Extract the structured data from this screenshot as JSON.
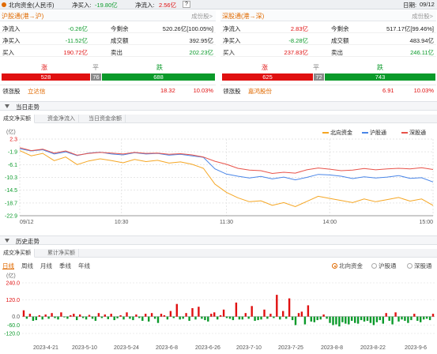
{
  "topbar": {
    "title": "北向资金(人民币)",
    "net_buy_label": "净买入:",
    "net_buy_value": "-19.80亿",
    "net_inflow_label": "净流入:",
    "net_inflow_value": "2.56亿",
    "help_icon": "?",
    "date_label": "日期:",
    "date_value": "09/12"
  },
  "sh_panel": {
    "title": "沪股通(港→沪)",
    "more": "成份股>",
    "rows": [
      {
        "l1": "净流入",
        "v1": "-0.26亿",
        "c1": "green",
        "l2": "今剩余",
        "v2": "520.26亿[100.05%]",
        "c2": "normal"
      },
      {
        "l1": "净买入",
        "v1": "-11.52亿",
        "c1": "green",
        "l2": "成交额",
        "v2": "392.95亿",
        "c2": "normal"
      },
      {
        "l1": "买入",
        "v1": "190.72亿",
        "c1": "red",
        "l2": "卖出",
        "v2": "202.23亿",
        "c2": "green"
      }
    ],
    "up_label": "涨",
    "flat_label": "平",
    "down_label": "跌",
    "up": "528",
    "flat": "76",
    "down": "688",
    "leader_label": "领涨股",
    "leader_name": "立达信",
    "leader_price": "18.32",
    "leader_pct": "10.03%"
  },
  "sz_panel": {
    "title": "深股通(港→深)",
    "more": "成份股>",
    "rows": [
      {
        "l1": "净流入",
        "v1": "2.83亿",
        "c1": "red",
        "l2": "今剩余",
        "v2": "517.17亿[99.46%]",
        "c2": "normal"
      },
      {
        "l1": "净买入",
        "v1": "-8.28亿",
        "c1": "green",
        "l2": "成交额",
        "v2": "483.94亿",
        "c2": "normal"
      },
      {
        "l1": "买入",
        "v1": "237.83亿",
        "c1": "red",
        "l2": "卖出",
        "v2": "246.11亿",
        "c2": "green"
      }
    ],
    "up_label": "涨",
    "flat_label": "平",
    "down_label": "跌",
    "up": "625",
    "flat": "72",
    "down": "743",
    "leader_label": "领涨股",
    "leader_name": "嘉鸿股份",
    "leader_price": "6.91",
    "leader_pct": "10.03%"
  },
  "intraday": {
    "section_title": "当日走势",
    "tabs": [
      "成交净买额",
      "资金净流入",
      "当日资金余额"
    ],
    "unit": "(亿)",
    "legend": [
      "北向资金",
      "沪股通",
      "深股通"
    ],
    "colors": {
      "north": "#f5a623",
      "sh": "#4a86e8",
      "sz": "#e8534a"
    },
    "chart_data": {
      "type": "line",
      "x_ticks": [
        "09/12",
        "10:30",
        "11:30",
        "14:00",
        "15:00"
      ],
      "y_ticks": [
        "2.3",
        "-1.9",
        "-6.1",
        "-10.3",
        "-14.5",
        "-18.7",
        "-22.9"
      ],
      "ylim": [
        -22.9,
        2.3
      ],
      "series": [
        {
          "name": "北向资金",
          "values": [
            -1.5,
            -3.2,
            -2.4,
            -4.8,
            -3.6,
            -6.1,
            -4.9,
            -4.2,
            -4.8,
            -5.5,
            -4.4,
            -5.1,
            -4.7,
            -5.6,
            -5.2,
            -6.0,
            -7.3,
            -12.5,
            -15.2,
            -17.0,
            -18.3,
            -18.0,
            -19.5,
            -18.6,
            -19.9,
            -18.2,
            -16.5,
            -17.2,
            -17.9,
            -18.6,
            -17.4,
            -18.3,
            -17.6,
            -16.9,
            -18.1,
            -17.4,
            -19.5
          ]
        },
        {
          "name": "沪股通",
          "values": [
            -0.9,
            -1.6,
            -1.2,
            -2.6,
            -1.9,
            -3.1,
            -2.3,
            -2.0,
            -2.6,
            -2.9,
            -2.2,
            -2.6,
            -2.4,
            -3.0,
            -2.7,
            -3.2,
            -3.7,
            -7.5,
            -9.2,
            -9.9,
            -10.5,
            -10.0,
            -10.8,
            -10.2,
            -11.1,
            -10.3,
            -9.3,
            -9.5,
            -9.9,
            -10.7,
            -10.1,
            -10.5,
            -10.2,
            -9.7,
            -10.6,
            -10.4,
            -11.8
          ]
        },
        {
          "name": "深股通",
          "values": [
            -0.5,
            -1.5,
            -1.0,
            -2.3,
            -1.6,
            -3.0,
            -2.4,
            -2.1,
            -2.3,
            -2.6,
            -2.1,
            -2.4,
            -2.3,
            -2.7,
            -2.5,
            -2.9,
            -3.6,
            -5.0,
            -6.0,
            -7.3,
            -7.9,
            -8.1,
            -9.0,
            -8.6,
            -8.9,
            -7.8,
            -7.2,
            -7.6,
            -8.1,
            -7.9,
            -7.4,
            -7.8,
            -7.5,
            -7.3,
            -7.5,
            -7.1,
            -7.7
          ]
        }
      ]
    }
  },
  "history": {
    "section_title": "历史走势",
    "tabs": [
      "成交净买额",
      "累计净买额"
    ],
    "periods": [
      "日线",
      "周线",
      "月线",
      "季线",
      "年线"
    ],
    "radios": [
      "北向资金",
      "沪股通",
      "深股通"
    ],
    "unit": "(亿)",
    "colors": {
      "pos": "#e01010",
      "neg": "#0a9a2a"
    },
    "chart_data": {
      "type": "bar",
      "y_ticks": [
        "240.0",
        "120.0",
        "0.0",
        "-60.0",
        "-120.0"
      ],
      "x_labels": [
        "2023-4-21",
        "2023-5-10",
        "2023-5-24",
        "2023-6-8",
        "2023-6-26",
        "2023-7-10",
        "2023-7-25",
        "2023-8-8",
        "2023-8-22",
        "2023-9-6"
      ],
      "ylim": [
        -120,
        240
      ],
      "values": [
        45,
        -15,
        20,
        -30,
        -25,
        10,
        -20,
        15,
        -15,
        25,
        -10,
        -20,
        30,
        -5,
        -15,
        10,
        20,
        -25,
        15,
        -10,
        -20,
        12,
        -15,
        -30,
        25,
        -10,
        15,
        -18,
        20,
        -25,
        -12,
        10,
        -20,
        30,
        -15,
        -25,
        15,
        -10,
        -30,
        20,
        -35,
        25,
        -15,
        -45,
        20,
        10,
        -20,
        40,
        -10,
        90,
        -20,
        -15,
        25,
        -30,
        60,
        -20,
        70,
        -15,
        -25,
        -35,
        20,
        30,
        -20,
        10,
        50,
        -10,
        -15,
        -25,
        100,
        -20,
        -20,
        25,
        -15,
        75,
        -30,
        -25,
        -20,
        50,
        -15,
        20,
        -10,
        155,
        -20,
        40,
        -15,
        130,
        -25,
        -60,
        25,
        35,
        -55,
        80,
        -35,
        -40,
        -25,
        -20,
        15,
        -15,
        -45,
        -60,
        -55,
        -70,
        -40,
        -50,
        -55,
        -30,
        -45,
        -50,
        -25,
        -35,
        -30,
        -45,
        -60,
        -40,
        -25,
        -50,
        25,
        -30,
        -55,
        30,
        -35,
        -20,
        -30,
        -45,
        -25,
        20,
        -30,
        -40,
        -20,
        -15,
        -25,
        20
      ]
    }
  }
}
